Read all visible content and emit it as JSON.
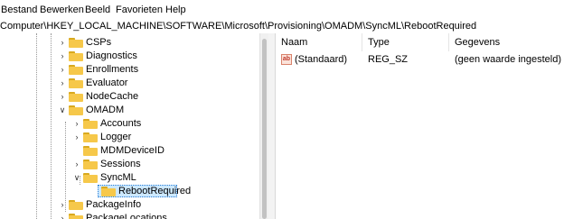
{
  "menu": [
    "Bestand",
    "Bewerken",
    "Beeld",
    "Favorieten",
    "Help"
  ],
  "address": "Computer\\HKEY_LOCAL_MACHINE\\SOFTWARE\\Microsoft\\Provisioning\\OMADM\\SyncML\\RebootRequired",
  "tree": [
    {
      "label": "CSPs",
      "expander": "collapsed"
    },
    {
      "label": "Diagnostics",
      "expander": "collapsed"
    },
    {
      "label": "Enrollments",
      "expander": "collapsed"
    },
    {
      "label": "Evaluator",
      "expander": "collapsed"
    },
    {
      "label": "NodeCache",
      "expander": "collapsed"
    },
    {
      "label": "OMADM",
      "expander": "expanded"
    },
    {
      "label": "Accounts",
      "expander": "collapsed"
    },
    {
      "label": "Logger",
      "expander": "collapsed"
    },
    {
      "label": "MDMDeviceID",
      "expander": "none"
    },
    {
      "label": "Sessions",
      "expander": "collapsed"
    },
    {
      "label": "SyncML",
      "expander": "expanded"
    },
    {
      "label": "RebootRequired",
      "expander": "none",
      "selected": true
    },
    {
      "label": "PackageInfo",
      "expander": "collapsed"
    },
    {
      "label": "PackageLocations",
      "expander": "collapsed"
    }
  ],
  "columns": {
    "name": "Naam",
    "type": "Type",
    "data": "Gegevens"
  },
  "values": [
    {
      "icon": "string-value-icon",
      "icon_text": "ab",
      "name": "(Standaard)",
      "type": "REG_SZ",
      "data": "(geen waarde ingesteld)"
    }
  ],
  "colors": {
    "folder": "#f6c84a",
    "selection": "#cce8ff"
  }
}
